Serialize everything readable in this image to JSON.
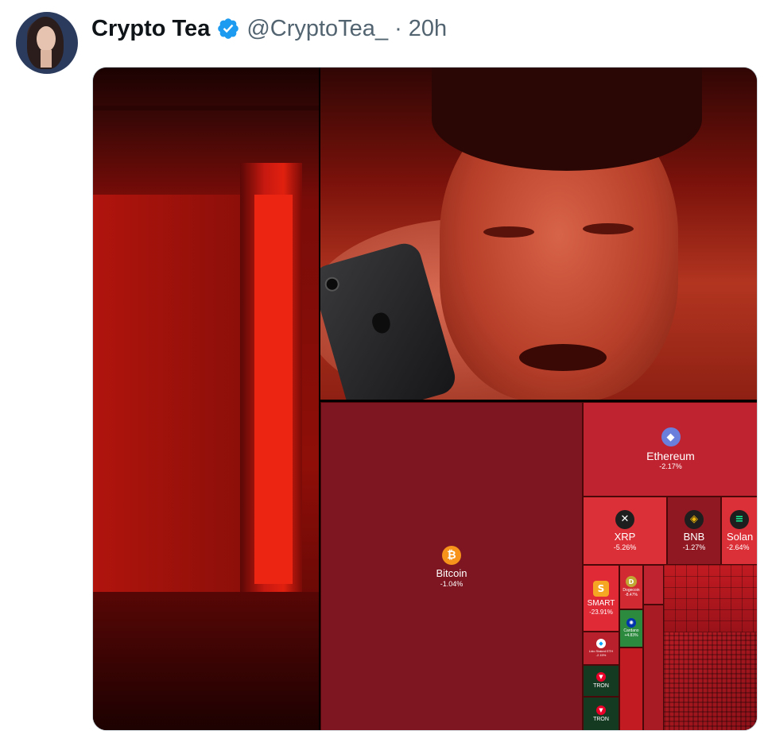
{
  "tweet": {
    "display_name": "Crypto Tea",
    "handle": "@CryptoTea_",
    "separator": "·",
    "time": "20h",
    "verified": true,
    "avatar_icon": "profile-avatar",
    "verified_icon": "verified-badge-icon",
    "accent_color": "#1d9bf0"
  },
  "media": {
    "phone_icon": "smartphone-icon",
    "heatmap": {
      "bitcoin": {
        "name": "Bitcoin",
        "change": "-1.04%",
        "icon": "bitcoin-icon",
        "color": "#7d1620"
      },
      "ethereum": {
        "name": "Ethereum",
        "change": "-2.17%",
        "icon": "ethereum-icon",
        "color": "#c02330"
      },
      "xrp": {
        "name": "XRP",
        "change": "-5.26%",
        "icon": "xrp-icon",
        "color": "#dc3038"
      },
      "bnb": {
        "name": "BNB",
        "change": "-1.27%",
        "icon": "bnb-icon",
        "color": "#8f1822"
      },
      "solana": {
        "name": "Solan",
        "change": "-2.64%",
        "icon": "solana-icon",
        "color": "#dc3038"
      },
      "smart": {
        "name": "SMART",
        "change": "-23.91%",
        "icon": "smart-icon",
        "color": "#e02a35"
      },
      "dogecoin": {
        "name": "Dogecoin",
        "change": "-8.47%",
        "icon": "dogecoin-icon",
        "color": "#d12a33"
      },
      "cardano": {
        "name": "Cardano",
        "change": "+4.83%",
        "icon": "cardano-icon",
        "color": "#2c8a3e"
      },
      "lido": {
        "name": "Lido Staked ETH",
        "change": "-2.15%",
        "icon": "lido-icon",
        "color": "#b8202b"
      },
      "tron1": {
        "name": "TRON",
        "icon": "tron-icon",
        "color": "#143b22"
      },
      "tron2": {
        "name": "TRON",
        "icon": "tron-icon",
        "color": "#143b22"
      }
    }
  }
}
